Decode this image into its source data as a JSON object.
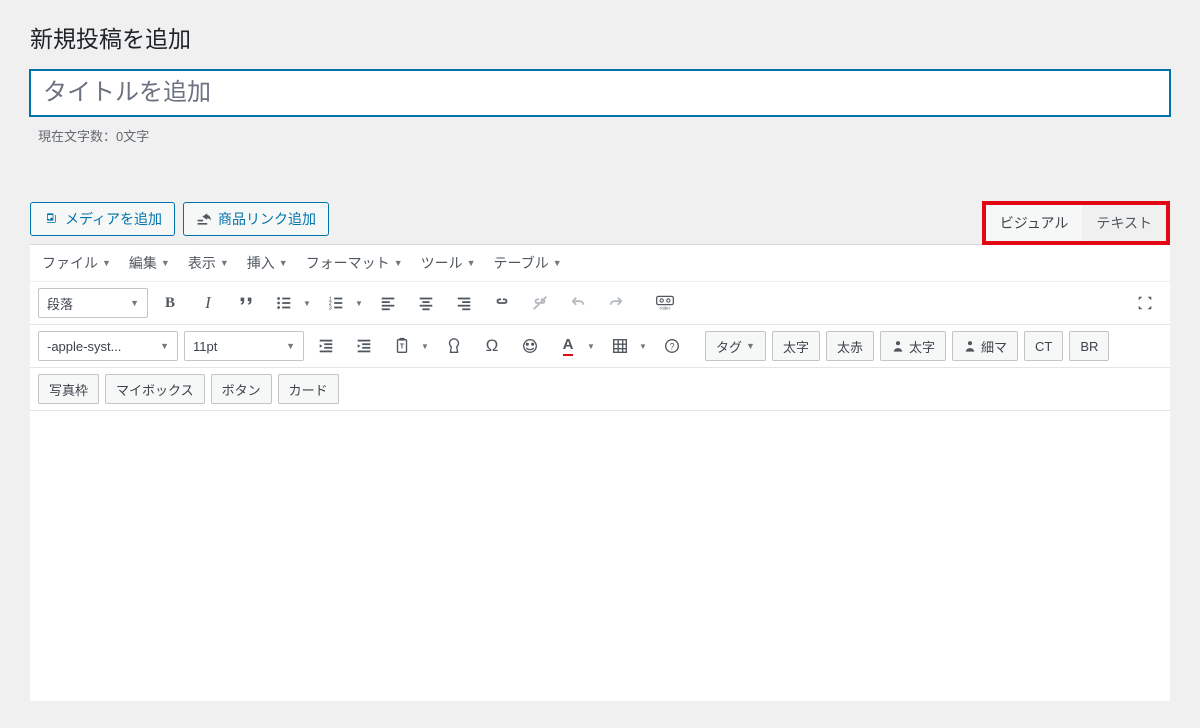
{
  "page_title": "新規投稿を追加",
  "title_placeholder": "タイトルを追加",
  "char_count_label": "現在文字数：0文字",
  "media_buttons": {
    "add_media": "メディアを追加",
    "product_link": "商品リンク追加"
  },
  "tabs": {
    "visual": "ビジュアル",
    "text": "テキスト"
  },
  "menubar": [
    "ファイル",
    "編集",
    "表示",
    "挿入",
    "フォーマット",
    "ツール",
    "テーブル"
  ],
  "toolbar_row1": {
    "paragraph_select": "段落"
  },
  "toolbar_row2": {
    "font_select": "-apple-syst...",
    "size_select": "11pt",
    "tag_btn": "タグ",
    "text_buttons": [
      "太字",
      "太赤",
      "太字",
      "細マ",
      "CT",
      "BR"
    ]
  },
  "toolbar_row3": {
    "buttons": [
      "写真枠",
      "マイボックス",
      "ボタン",
      "カード"
    ]
  }
}
